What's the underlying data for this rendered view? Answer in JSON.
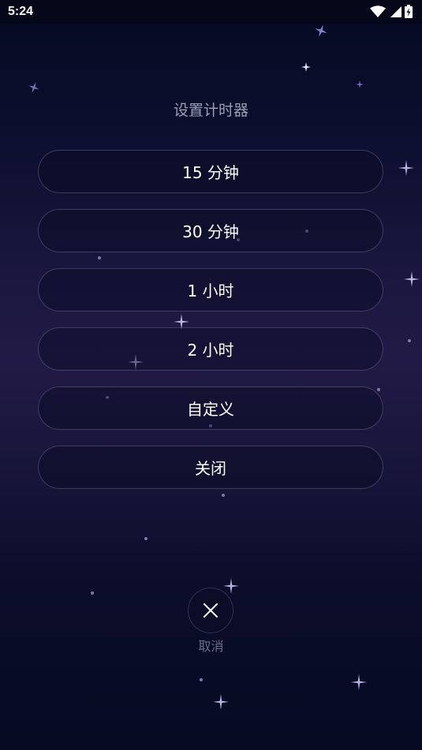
{
  "status_bar": {
    "time": "5:24",
    "icons": [
      "wifi-icon",
      "signal-icon",
      "battery-charging-icon"
    ]
  },
  "timer_dialog": {
    "title": "设置计时器",
    "options": [
      {
        "label": "15 分钟"
      },
      {
        "label": "30 分钟"
      },
      {
        "label": "1 小时"
      },
      {
        "label": "2 小时"
      },
      {
        "label": "自定义"
      },
      {
        "label": "关闭"
      }
    ],
    "cancel": {
      "icon": "close-icon",
      "label": "取消"
    }
  },
  "colors": {
    "background_top": "#050a22",
    "background_mid": "#221a46",
    "title_text": "#9a9fb4",
    "option_border": "#5a5678",
    "cancel_text": "#6b6f86"
  }
}
